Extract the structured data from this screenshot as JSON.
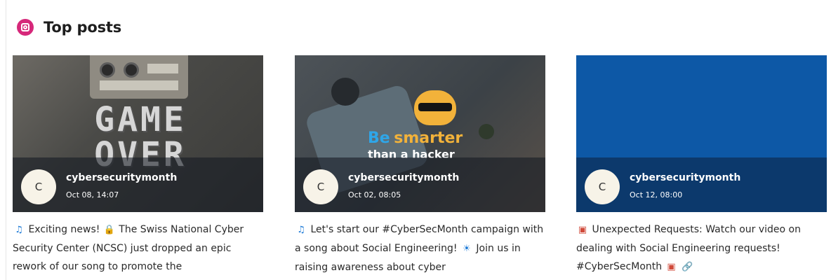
{
  "header": {
    "title": "Top posts",
    "icon": "instagram-icon",
    "icon_color": "#d6287a"
  },
  "posts": [
    {
      "author": "cybersecuritymonth",
      "date": "Oct 08, 14:07",
      "avatar_letter": "C",
      "image": {
        "text_line1": "GAME",
        "text_line2": "OVER"
      },
      "caption": {
        "e1": "♫",
        "t1": " Exciting news! ",
        "e2": "🔒",
        "t2": " The Swiss National Cyber Security Center (NCSC) just dropped an epic rework of our song to promote the"
      }
    },
    {
      "author": "cybersecuritymonth",
      "date": "Oct 02, 08:05",
      "avatar_letter": "C",
      "image": {
        "slogan_be": "Be",
        "slogan_smarter": "smarter",
        "slogan_rest": "than a hacker"
      },
      "caption": {
        "e1": "♫",
        "t1": " Let's start our #CyberSecMonth campaign with a song about Social Engineering! ",
        "e2": "☀",
        "t2": " Join us in raising awareness about cyber"
      }
    },
    {
      "author": "cybersecuritymonth",
      "date": "Oct 12, 08:00",
      "avatar_letter": "C",
      "caption": {
        "e1": "▣",
        "t1": " Unexpected Requests: Watch our video on dealing with Social Engineering requests! #CyberSecMonth ",
        "e2": "▣",
        "t2": " ",
        "e3": "🔗"
      }
    }
  ]
}
